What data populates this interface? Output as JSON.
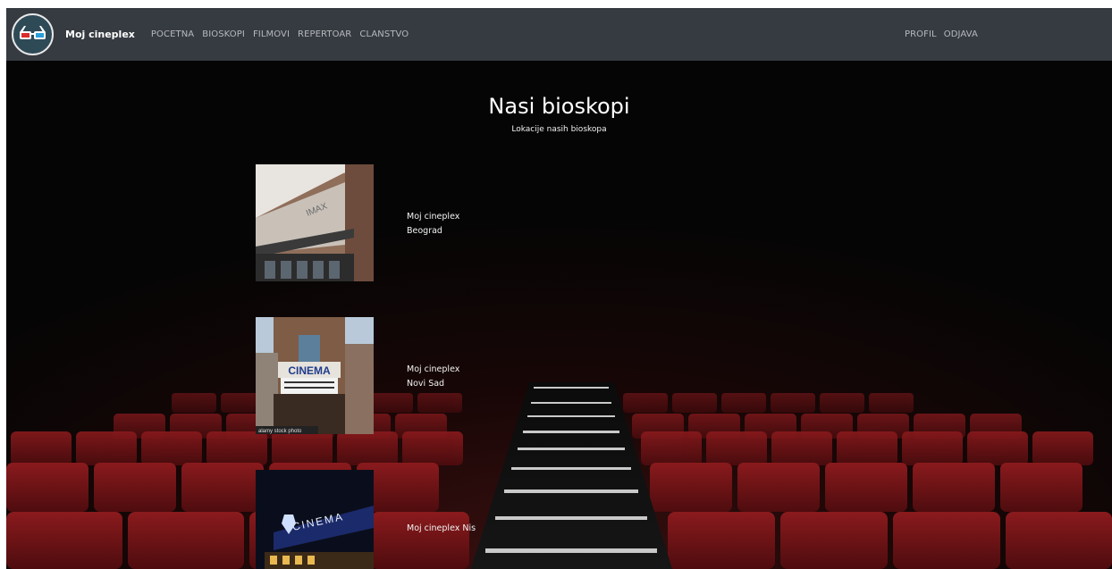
{
  "navbar": {
    "brand": "Moj cineplex",
    "links": [
      "POCETNA",
      "BIOSKOPI",
      "FILMOVI",
      "REPERTOAR",
      "CLANSTVO"
    ],
    "right_links": [
      "PROFIL",
      "ODJAVA"
    ]
  },
  "header": {
    "title": "Nasi bioskopi",
    "subtitle": "Lokacije nasih bioskopa"
  },
  "cinemas": [
    {
      "line1": "Moj cineplex",
      "line2": "Beograd",
      "sign": "IMAX"
    },
    {
      "line1": "Moj cineplex",
      "line2": "Novi Sad",
      "sign": "CINEMA",
      "watermark": "alamy stock photo"
    },
    {
      "line1": "Moj cineplex Nis",
      "line2": "",
      "sign": "CINEMA"
    }
  ],
  "colors": {
    "navbar": "#363b41",
    "seat": "#7a1518",
    "background": "#050505"
  },
  "icons": {
    "logo": "3d-glasses-icon"
  }
}
